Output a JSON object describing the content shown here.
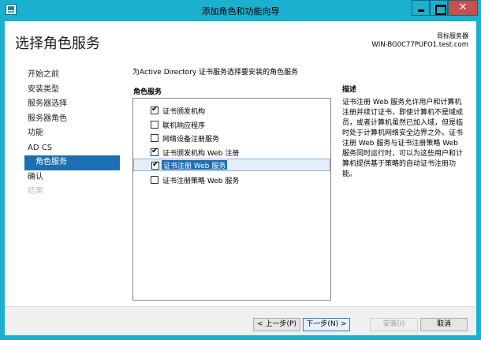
{
  "window": {
    "title": "添加角色和功能向导"
  },
  "header": {
    "page_title": "选择角色服务",
    "server_label": "目标服务器",
    "server_name": "WIN-BG0C77PUFO1.test.com"
  },
  "nav": {
    "items": [
      {
        "label": "开始之前",
        "state": "normal"
      },
      {
        "label": "安装类型",
        "state": "normal"
      },
      {
        "label": "服务器选择",
        "state": "normal"
      },
      {
        "label": "服务器角色",
        "state": "normal"
      },
      {
        "label": "功能",
        "state": "normal"
      },
      {
        "label": "AD CS",
        "state": "normal"
      },
      {
        "label": "角色服务",
        "state": "active"
      },
      {
        "label": "确认",
        "state": "normal"
      },
      {
        "label": "结果",
        "state": "disabled"
      }
    ]
  },
  "main": {
    "intro": "为Active Directory 证书服务选择要安装的角色服务",
    "role_services_label": "角色服务",
    "role_services": [
      {
        "label": "证书颁发机构",
        "checked": true,
        "selected": false
      },
      {
        "label": "联机响应程序",
        "checked": false,
        "selected": false
      },
      {
        "label": "网络设备注册服务",
        "checked": false,
        "selected": false
      },
      {
        "label": "证书颁发机构 Web 注册",
        "checked": true,
        "selected": false
      },
      {
        "label": "证书注册 Web 服务",
        "checked": true,
        "selected": true
      },
      {
        "label": "证书注册策略 Web 服务",
        "checked": false,
        "selected": false
      }
    ],
    "description_label": "描述",
    "description": "证书注册 Web 服务允许用户和计算机注册并续订证书，即使计算机不是域成员，或者计算机虽然已加入域，但是临时处于计算机网络安全边界之外。证书注册 Web 服务与证书注册策略 Web 服务同时运行时，可以为这些用户和计算机提供基于策略的自动证书注册功能。"
  },
  "footer": {
    "prev_label": "< 上一步(P)",
    "next_label": "下一步(N) >",
    "install_label": "安装(I)",
    "cancel_label": "取消"
  },
  "colors": {
    "titlebar": "#1bb0ce",
    "accent": "#1c6fb3",
    "close": "#c7504b"
  }
}
